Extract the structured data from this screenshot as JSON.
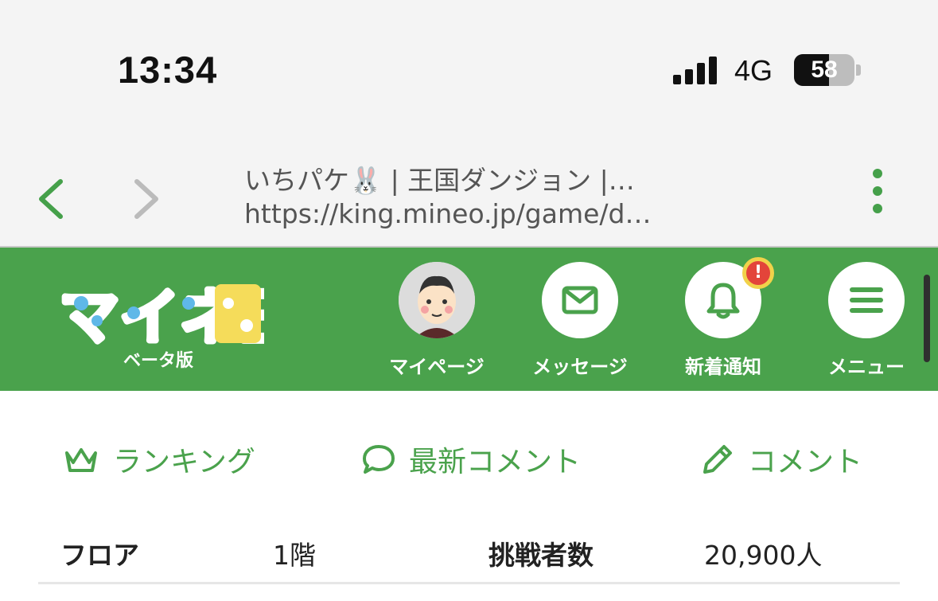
{
  "status_bar": {
    "time": "13:34",
    "network": "4G",
    "battery": "58",
    "battery_level": 0.58
  },
  "browser": {
    "tab_title": "いちパケ🐰 | 王国ダンジョン |…",
    "url": "https://king.mineo.jp/game/d…",
    "back_icon": "chevron-left-icon",
    "forward_icon": "chevron-right-icon",
    "menu_icon": "kebab-icon"
  },
  "header": {
    "logo_text": "マイネ王",
    "beta_label": "ベータ版",
    "buttons": [
      {
        "label": "マイページ",
        "icon": "avatar"
      },
      {
        "label": "メッセージ",
        "icon": "envelope-icon"
      },
      {
        "label": "新着通知",
        "icon": "bell-icon",
        "badge": "!"
      },
      {
        "label": "メニュー",
        "icon": "hamburger-icon"
      }
    ]
  },
  "actions": [
    {
      "label": "ランキング",
      "icon": "crown-icon"
    },
    {
      "label": "最新コメント",
      "icon": "speech-bubble-icon"
    },
    {
      "label": "コメント",
      "icon": "pencil-icon"
    }
  ],
  "stats": {
    "floor_label": "フロア",
    "floor_value": "1階",
    "challengers_label": "挑戦者数",
    "challengers_value": "20,900人"
  },
  "colors": {
    "brand_green": "#4aa24c",
    "badge_red": "#e3443a",
    "badge_ring": "#f1d24a"
  }
}
